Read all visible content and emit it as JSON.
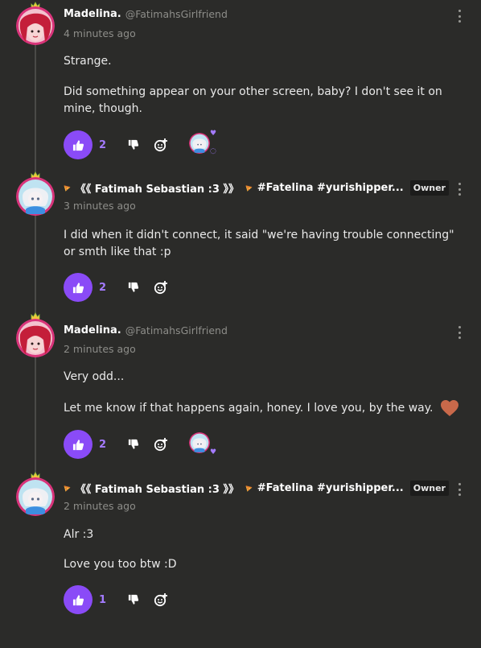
{
  "comments": [
    {
      "author": "Madelina.",
      "handle": "@FatimahsGirlfriend",
      "time": "4 minutes ago",
      "paragraphs": [
        "Strange.",
        "Did something appear on your other screen, baby? I don't see it on mine, though."
      ],
      "likes": "2",
      "avatar": "red-hair-avatar",
      "reactor": "white-hair-avatar"
    },
    {
      "author_prefix": "《《 Fatimah Sebastian :3 》》",
      "author_suffix": "#Fatelina #yurishipper...",
      "badge": "Owner",
      "time": "3 minutes ago",
      "paragraphs": [
        "I did when it didn't connect, it said \"we're having trouble connecting\" or smth like that :p"
      ],
      "likes": "2",
      "avatar": "white-hair-avatar"
    },
    {
      "author": "Madelina.",
      "handle": "@FatimahsGirlfriend",
      "time": "2 minutes ago",
      "paragraphs": [
        "Very odd...",
        "Let me know if that happens again, honey. I love you, by the way."
      ],
      "likes": "2",
      "avatar": "red-hair-avatar",
      "reactor": "white-hair-avatar"
    },
    {
      "author_prefix": "《《 Fatimah Sebastian :3 》》",
      "author_suffix": "#Fatelina #yurishipper...",
      "badge": "Owner",
      "time": "2 minutes ago",
      "paragraphs": [
        "Alr :3",
        "Love you too btw :D"
      ],
      "likes": "1",
      "avatar": "white-hair-avatar"
    }
  ],
  "colors": {
    "background": "#2b2b29",
    "accent": "#8a4bf7",
    "like_count": "#a47bff",
    "muted": "#8d8d89"
  },
  "icons": [
    "thumbs-up-icon",
    "thumbs-down-icon",
    "add-reaction-icon",
    "kebab-menu-icon",
    "pizza-icon",
    "crown-icon",
    "heart-icon"
  ]
}
